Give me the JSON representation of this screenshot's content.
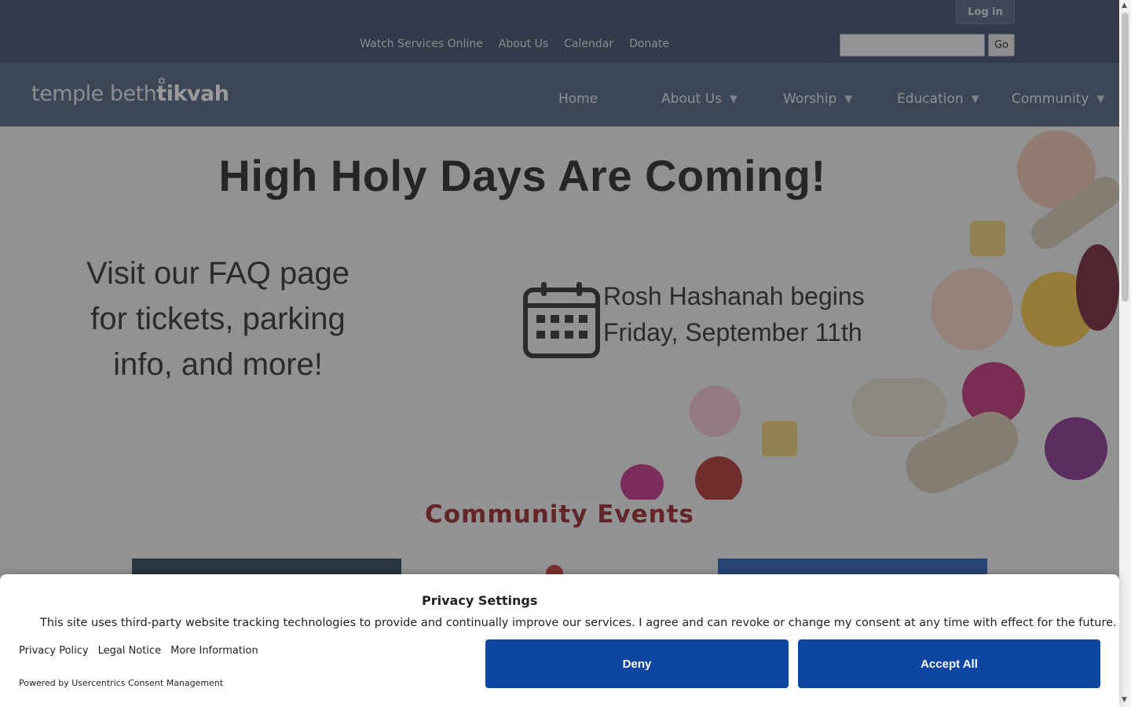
{
  "utility_bar": {
    "login_label": "Log in",
    "links": [
      "Watch Services Online",
      "About Us",
      "Calendar",
      "Donate"
    ],
    "search_placeholder": "",
    "go_label": "Go"
  },
  "logo": {
    "text_light": "temple beth",
    "text_bold": "tikvah"
  },
  "nav": {
    "items": [
      {
        "label": "Home",
        "has_caret": false
      },
      {
        "label": "About Us",
        "has_caret": true
      },
      {
        "label": "Worship",
        "has_caret": true
      },
      {
        "label": "Education",
        "has_caret": true
      },
      {
        "label": "Community",
        "has_caret": true
      }
    ],
    "caret_icon": "▼"
  },
  "hero": {
    "title": "High Holy Days Are Coming!",
    "faq_line1": "Visit our FAQ page",
    "faq_line2": "for tickets, parking",
    "faq_line3": "info, and more!",
    "date_line1": "Rosh Hashanah begins",
    "date_line2": "Friday, September 11th"
  },
  "events": {
    "title": "Community Events"
  },
  "privacy": {
    "title": "Privacy Settings",
    "text": "This site uses third-party website tracking technologies to provide and continually improve our services. I agree and can revoke or change my consent at any time with effect for the future.",
    "links": [
      "Privacy Policy",
      "Legal Notice",
      "More Information"
    ],
    "powered_by": "Powered by Usercentrics Consent Management",
    "deny_label": "Deny",
    "accept_label": "Accept All"
  },
  "colors": {
    "header_dark": "#44536a",
    "header_nav": "#56667f",
    "events_title": "#9a2c2c",
    "consent_button": "#0e47a1"
  }
}
